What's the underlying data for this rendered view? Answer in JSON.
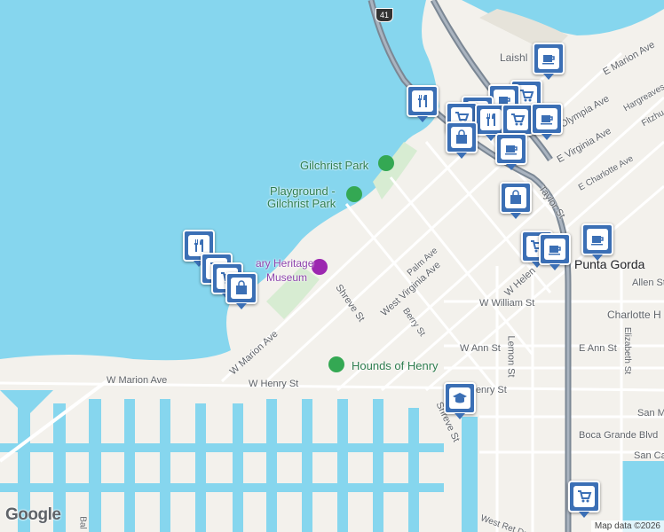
{
  "map": {
    "place": "Punta Gorda",
    "attribution": "Map data ©2026",
    "logo": "Google",
    "colors": {
      "water": "#86d6ee",
      "land": "#f3f1ec",
      "marker": "#3b6fb5",
      "park": "#2e7d4f",
      "museum": "#9c27b0",
      "highway": "#7b8794"
    },
    "highway_shield": "41"
  },
  "street_labels": [
    "W Marion Ave",
    "W Henry St",
    "W Marion Ave",
    "Shreve St",
    "West Virginia Ave",
    "Palm Ave",
    "Berry St",
    "W William St",
    "W Ann St",
    "E Ann St",
    "Lemon St",
    "W Helen",
    "Taylor St",
    "E Virginia Ave",
    "E Charlotte Ave",
    "Olympia Ave",
    "E Marion Ave",
    "Hargreaves",
    "Fitzhu",
    "Allen St",
    "Elizabeth St",
    "Henry St",
    "Shreve St",
    "San M",
    "Boca Grande Blvd",
    "San Ca",
    "West Ret Dr",
    "Bal"
  ],
  "place_labels": {
    "gilchrist_park": "Gilchrist Park",
    "playground_1": "Playground -",
    "playground_2": "Gilchrist Park",
    "hounds": "Hounds of Henry",
    "museum_1": "ary Heritage",
    "museum_2": "Museum",
    "laishl": "Laishl",
    "charlotte": "Charlotte H",
    "punta_gorda": "Punta Gorda"
  },
  "markers": [
    {
      "type": "restaurant",
      "icon": "fork-knife-icon"
    },
    {
      "type": "restaurant",
      "icon": "fork-knife-icon"
    },
    {
      "type": "store",
      "icon": "shopping-bag-icon"
    },
    {
      "type": "cafe",
      "icon": "coffee-cup-icon"
    },
    {
      "type": "grocery",
      "icon": "shopping-cart-icon"
    },
    {
      "type": "cafe",
      "icon": "coffee-cup-icon"
    },
    {
      "type": "store",
      "icon": "shopping-bag-icon"
    },
    {
      "type": "cafe",
      "icon": "coffee-cup-icon"
    },
    {
      "type": "cafe",
      "icon": "coffee-cup-icon"
    },
    {
      "type": "grocery",
      "icon": "shopping-cart-icon"
    },
    {
      "type": "school",
      "icon": "graduation-cap-icon"
    },
    {
      "type": "grocery",
      "icon": "shopping-cart-icon"
    }
  ]
}
